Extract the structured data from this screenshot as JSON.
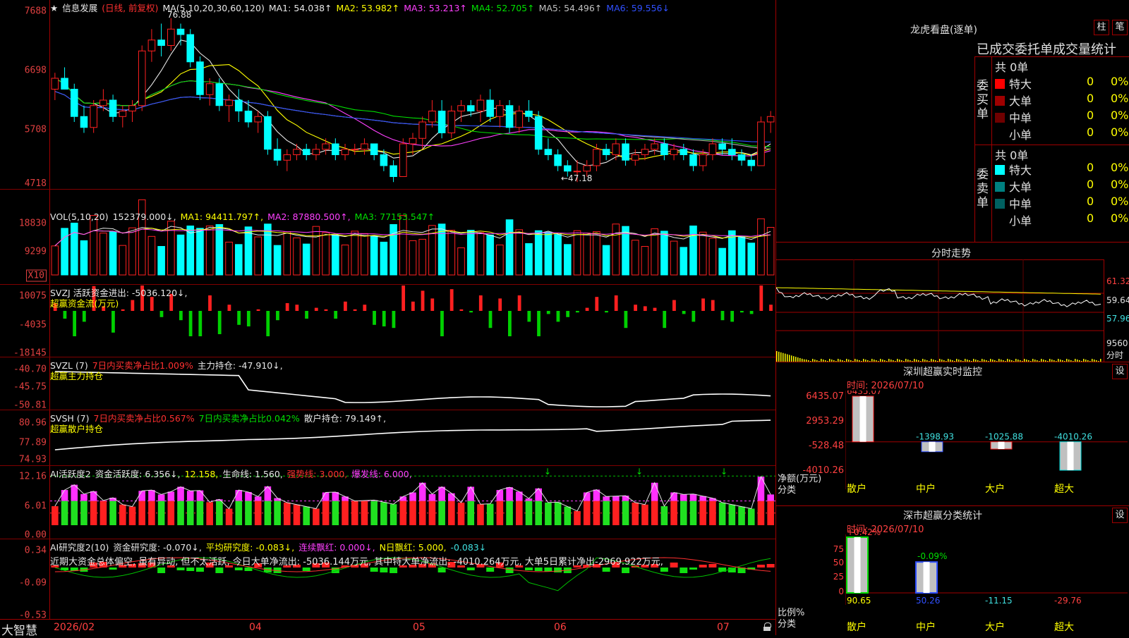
{
  "kline": {
    "star_label": "★",
    "stock_name": "信息发展",
    "period": "(日线, 前复权)",
    "ma_spec": "MA(5,10,20,30,60,120)",
    "ma_items": [
      {
        "label": "MA1: 54.038↑",
        "color": "#e8e8e8"
      },
      {
        "label": "MA2: 53.982↑",
        "color": "#ffff00"
      },
      {
        "label": "MA3: 53.213↑",
        "color": "#ff40ff"
      },
      {
        "label": "MA4: 52.705↑",
        "color": "#00e000"
      },
      {
        "label": "MA5: 54.496↑",
        "color": "#c0c0c0"
      },
      {
        "label": "MA6: 59.556↓",
        "color": "#3050ff"
      }
    ],
    "y_labels": [
      "7688",
      "6698",
      "5708",
      "4718"
    ],
    "high_label": "76.88",
    "low_label": "←47.18",
    "up_color": "#ff2020",
    "down_color": "#00ffff",
    "candles": [
      [
        64,
        67,
        62,
        66
      ],
      [
        66,
        68,
        64,
        64
      ],
      [
        64,
        65,
        58,
        59
      ],
      [
        59,
        61,
        56,
        57
      ],
      [
        57,
        62,
        56,
        61
      ],
      [
        61,
        64,
        60,
        62
      ],
      [
        62,
        63,
        58,
        59
      ],
      [
        59,
        61,
        57,
        60
      ],
      [
        60,
        62,
        58,
        61
      ],
      [
        61,
        72,
        60,
        71
      ],
      [
        71,
        75,
        69,
        73
      ],
      [
        73,
        76,
        70,
        72
      ],
      [
        72,
        77,
        71,
        75
      ],
      [
        75,
        76,
        72,
        74
      ],
      [
        74,
        75,
        68,
        69
      ],
      [
        69,
        70,
        62,
        63
      ],
      [
        63,
        66,
        61,
        65
      ],
      [
        65,
        66,
        60,
        61
      ],
      [
        61,
        63,
        58,
        62
      ],
      [
        62,
        64,
        58,
        60
      ],
      [
        60,
        62,
        57,
        58
      ],
      [
        58,
        60,
        56,
        59
      ],
      [
        59,
        60,
        52,
        53
      ],
      [
        53,
        55,
        50,
        51
      ],
      [
        51,
        53,
        49,
        52
      ],
      [
        52,
        54,
        51,
        53
      ],
      [
        53,
        54,
        51,
        52
      ],
      [
        52,
        54,
        51,
        53
      ],
      [
        53,
        55,
        52,
        54
      ],
      [
        54,
        55,
        51,
        52
      ],
      [
        52,
        54,
        51,
        53
      ],
      [
        53,
        54,
        52,
        53
      ],
      [
        53,
        55,
        52,
        54
      ],
      [
        54,
        54,
        51,
        52
      ],
      [
        52,
        53,
        49,
        50
      ],
      [
        50,
        51,
        47,
        48
      ],
      [
        48,
        55,
        48,
        54
      ],
      [
        54,
        56,
        52,
        55
      ],
      [
        55,
        59,
        53,
        58
      ],
      [
        58,
        62,
        57,
        60
      ],
      [
        60,
        62,
        55,
        56
      ],
      [
        56,
        61,
        55,
        60
      ],
      [
        60,
        62,
        58,
        61
      ],
      [
        61,
        62,
        59,
        60
      ],
      [
        60,
        63,
        58,
        62
      ],
      [
        62,
        64,
        58,
        59
      ],
      [
        59,
        62,
        57,
        61
      ],
      [
        61,
        62,
        56,
        57
      ],
      [
        57,
        61,
        56,
        60
      ],
      [
        60,
        62,
        58,
        59
      ],
      [
        59,
        60,
        52,
        53
      ],
      [
        53,
        55,
        51,
        52
      ],
      [
        52,
        53,
        49,
        50
      ],
      [
        50,
        51,
        48,
        49
      ],
      [
        49,
        51,
        47,
        49
      ],
      [
        49,
        51,
        48,
        50
      ],
      [
        50,
        54,
        49,
        53
      ],
      [
        53,
        54,
        51,
        52
      ],
      [
        52,
        55,
        51,
        54
      ],
      [
        54,
        55,
        50,
        51
      ],
      [
        51,
        53,
        50,
        52
      ],
      [
        52,
        54,
        51,
        53
      ],
      [
        53,
        55,
        52,
        54
      ],
      [
        54,
        55,
        51,
        52
      ],
      [
        52,
        54,
        51,
        53
      ],
      [
        53,
        54,
        51,
        52
      ],
      [
        52,
        53,
        49,
        50
      ],
      [
        50,
        53,
        49,
        52
      ],
      [
        52,
        55,
        51,
        54
      ],
      [
        54,
        55,
        52,
        53
      ],
      [
        53,
        55,
        51,
        52
      ],
      [
        52,
        53,
        50,
        51
      ],
      [
        51,
        52,
        49,
        50
      ],
      [
        50,
        59,
        50,
        58
      ],
      [
        58,
        60,
        56,
        59
      ]
    ]
  },
  "vol": {
    "label": "VOL(5,10,20)",
    "value": "152379.000↓,",
    "ma1": "MA1: 94411.797↑,",
    "ma2": "MA2: 87880.500↑,",
    "ma3": "MA3: 77153.547↑",
    "y_labels": [
      "18830",
      "9299"
    ],
    "unit": "X10"
  },
  "svzj": {
    "line1": "SVZJ  活跃资金进出: -5036.120↓,",
    "line2": "超赢资金流(万元)",
    "y_labels": [
      "10075",
      "-4035",
      "-18145"
    ]
  },
  "svzl": {
    "name": "SVZL (7)",
    "p1": "7日内买卖净占比1.009%",
    "p2": "主力持仓: -47.910↓,",
    "line2": "超赢主力持仓",
    "y_labels": [
      "-40.70",
      "-45.75",
      "-50.81"
    ]
  },
  "svsh": {
    "name": "SVSH (7)",
    "p1": "7日内买卖净占比0.567%",
    "p2": "7日内买卖净占比0.042%",
    "p3": "散户持仓: 79.149↑,",
    "line2": "超赢散户持仓",
    "y_labels": [
      "80.96",
      "77.89",
      "74.93"
    ]
  },
  "ai1": {
    "name": "AI活跃度2",
    "p1": "资金活跃度: 6.356↓,",
    "p2": "12.158,",
    "p3": "生命线: 1.560,",
    "p4": "强势线: 3.000,",
    "p5": "爆发线: 6.000,",
    "y_labels": [
      "12.16",
      "6.01",
      "0.00"
    ]
  },
  "ai2": {
    "name": "AI研究度2(10)",
    "p1": "资金研究度: -0.070↓,",
    "p2": "平均研究度: -0.083↓,",
    "p3": "连续飘红: 0.000↓,",
    "p4": "N日飘红: 5.000,",
    "p5": "-0.083↓",
    "commentary": "近期大资金总体偏空, 虽有异动, 但不太活跃, 今日大单净流出: -5036.144万元, 其中特大单净流出: -4010.264万元, 大单5日累计净出-2969.922万元,",
    "y_labels": [
      "0.34",
      "-0.09",
      "-0.53"
    ]
  },
  "footer": {
    "app_name": "大智慧",
    "dates": [
      "2026/02",
      "04",
      "05",
      "06",
      "07"
    ]
  },
  "lhb": {
    "title": "龙虎看盘(逐单)",
    "btn1": "柱",
    "btn2": "笔",
    "subtitle": "已成交委托单成交量统计",
    "buy_side": "委买单",
    "sell_side": "委卖单",
    "buy_total": "共 0单",
    "sell_total": "共 0单",
    "buy_rows": [
      {
        "color": "#ff0000",
        "name": "特大",
        "val": "0",
        "pct": "0%"
      },
      {
        "color": "#a00000",
        "name": "大单",
        "val": "0",
        "pct": "0%"
      },
      {
        "color": "#700000",
        "name": "中单",
        "val": "0",
        "pct": "0%"
      },
      {
        "color": "",
        "name": "小单",
        "val": "0",
        "pct": "0%"
      }
    ],
    "sell_rows": [
      {
        "color": "#00ffff",
        "name": "特大",
        "val": "0",
        "pct": "0%"
      },
      {
        "color": "#008080",
        "name": "大单",
        "val": "0",
        "pct": "0%"
      },
      {
        "color": "#006060",
        "name": "中单",
        "val": "0",
        "pct": "0%"
      },
      {
        "color": "",
        "name": "小单",
        "val": "0",
        "pct": "0%"
      }
    ]
  },
  "fenshi": {
    "title": "分时走势",
    "y_labels": [
      "61.32",
      "59.64",
      "57.96",
      "9560"
    ],
    "unit": "分时"
  },
  "monitor": {
    "title": "深圳超赢实时监控",
    "btn": "设",
    "time": "时间: 2026/07/10",
    "y_labels": [
      "6435.07",
      "2953.29",
      "-528.48",
      "-4010.26"
    ],
    "ylabel1": "净额(万元)",
    "ylabel2": "分类",
    "categories": [
      "散户",
      "中户",
      "大户",
      "超大"
    ],
    "values": [
      6435.07,
      -1398.93,
      -1025.88,
      -4010.26
    ],
    "value_labels": [
      "6435.07",
      "-1398.93",
      "-1025.88",
      "-4010.26"
    ]
  },
  "classify": {
    "title": "深市超赢分类统计",
    "btn": "设",
    "time": "时间: 2026/07/10",
    "y_labels": [
      "75",
      "50",
      "25",
      "0"
    ],
    "top_labels": [
      "+0.42%",
      "-0.09%"
    ],
    "ylabel1": "比例%",
    "ylabel2": "分类",
    "categories": [
      "散户",
      "中户",
      "大户",
      "超大"
    ],
    "values": [
      90.65,
      50.26,
      -11.15,
      -29.76
    ],
    "value_labels": [
      "90.65",
      "50.26",
      "-11.15",
      "-29.76"
    ]
  }
}
